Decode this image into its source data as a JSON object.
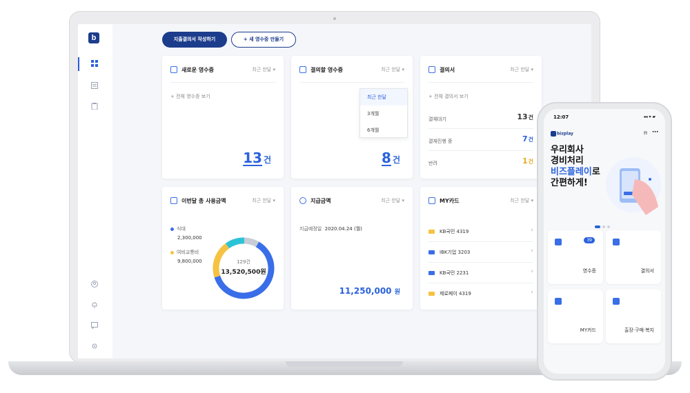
{
  "toolbar": {
    "primary_label": "지출결의서 작성하기",
    "new_receipt_label": "+ 새 영수증 만들기"
  },
  "cards": {
    "new_receipts": {
      "title": "새로운 영수증",
      "period": "최근 한달 ▾",
      "link": "+ 전체 영수증 보기",
      "count": "13",
      "unit": "건"
    },
    "approve_receipts": {
      "title": "결의할 영수증",
      "period": "최근 한달 ▾",
      "count": "8",
      "unit": "건"
    },
    "approvals": {
      "title": "결의서",
      "period": "최근 한달 ▾",
      "link": "+ 전체 결의서 보기",
      "rows": [
        {
          "label": "결재대기",
          "value": "13",
          "unit": "건"
        },
        {
          "label": "결재진행 중",
          "value": "7",
          "unit": "건"
        },
        {
          "label": "반려",
          "value": "1",
          "unit": "건"
        }
      ]
    },
    "monthly_spend": {
      "title": "이번달 총 사용금액",
      "period": "최근 한달 ▾",
      "legend": [
        {
          "label": "식대",
          "value": "2,300,000",
          "color": "#3a6ee8"
        },
        {
          "label": "여비교통비",
          "value": "9,800,000",
          "color": "#f5c242"
        }
      ],
      "donut_count": "129건",
      "donut_total": "13,520,500원"
    },
    "payment": {
      "title": "지급금액",
      "period": "최근 한달 ▾",
      "date_label": "지급예정일",
      "date_value": "2020.04.24 (월)",
      "amount": "11,250,000",
      "unit": "원"
    },
    "my_cards": {
      "title": "MY카드",
      "period": "최근 한달 ▾",
      "items": [
        {
          "label": "KB국민 4319",
          "color": "#f5c242"
        },
        {
          "label": "IBK기업 3203",
          "color": "#3a6ee8"
        },
        {
          "label": "KB국민 2231",
          "color": "#3a6ee8"
        },
        {
          "label": "제로페이 4319",
          "color": "#f5c242"
        }
      ]
    }
  },
  "dropdown": {
    "items": [
      "최근 한달",
      "3개월",
      "6개월"
    ]
  },
  "phone": {
    "time": "12:07",
    "status": "◂◂ ▾ ▰",
    "logo": "bizplay",
    "hero_line1": "우리회사",
    "hero_line2": "경비처리",
    "hero_highlight": "비즈플레이",
    "hero_line3_suffix": "로",
    "hero_line4": "간편하게!",
    "tiles": [
      {
        "label": "영수증",
        "badge": "39"
      },
      {
        "label": "결의서"
      },
      {
        "label": "MY카드"
      },
      {
        "label": "출장·구매·복지"
      }
    ]
  }
}
